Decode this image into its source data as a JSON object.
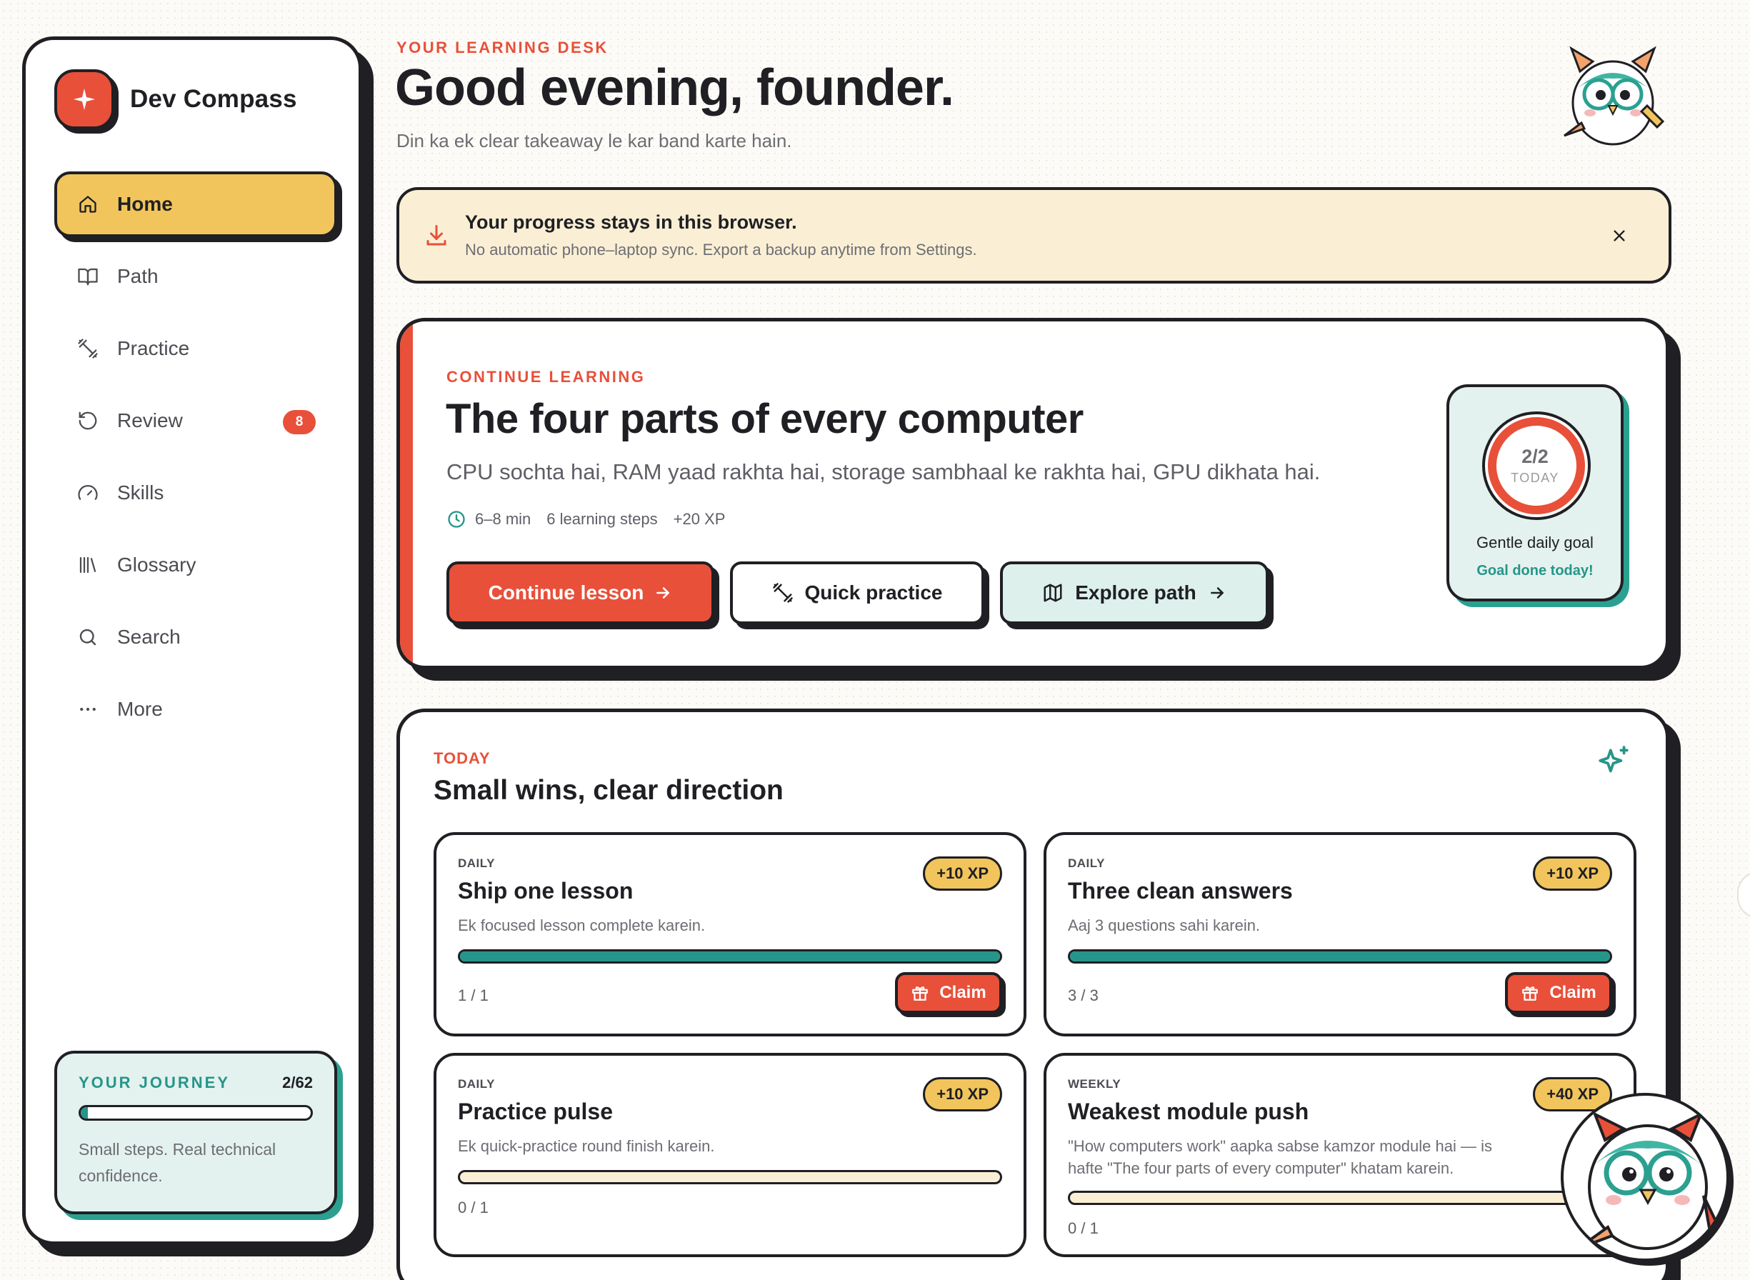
{
  "brand": {
    "name": "Dev Compass",
    "accent": "#e8503a"
  },
  "sidebar": {
    "items": [
      {
        "label": "Home",
        "icon": "home-icon",
        "active": true
      },
      {
        "label": "Path",
        "icon": "book-open-icon"
      },
      {
        "label": "Practice",
        "icon": "dumbbell-icon"
      },
      {
        "label": "Review",
        "icon": "rotate-ccw-icon",
        "badge": "8"
      },
      {
        "label": "Skills",
        "icon": "gauge-icon"
      },
      {
        "label": "Glossary",
        "icon": "library-icon"
      },
      {
        "label": "Search",
        "icon": "search-icon"
      },
      {
        "label": "More",
        "icon": "more-horizontal-icon"
      }
    ],
    "journey": {
      "title": "YOUR JOURNEY",
      "count": "2/62",
      "progress": 0.032,
      "text": "Small steps. Real technical confidence."
    }
  },
  "header": {
    "eyebrow": "YOUR LEARNING DESK",
    "title": "Good evening, founder.",
    "subtitle": "Din ka ek clear takeaway le kar band karte hain."
  },
  "notice": {
    "title": "Your progress stays in this browser.",
    "subtitle": "No automatic phone–laptop sync. Export a backup anytime from Settings."
  },
  "continue": {
    "eyebrow": "CONTINUE LEARNING",
    "title": "The four parts of every computer",
    "description": "CPU sochta hai, RAM yaad rakhta hai, storage sambhaal ke rakhta hai, GPU dikhata hai.",
    "meta": {
      "duration": "6–8 min",
      "steps": "6 learning steps",
      "xp": "+20 XP"
    },
    "buttons": {
      "primary": "Continue lesson",
      "practice": "Quick practice",
      "explore": "Explore path"
    },
    "goal": {
      "value": "2/2",
      "today": "TODAY",
      "progress": 1.0,
      "title": "Gentle daily goal",
      "status": "Goal done today!"
    }
  },
  "today": {
    "eyebrow": "TODAY",
    "title": "Small wins, clear direction",
    "quests": [
      {
        "kind": "DAILY",
        "title": "Ship one lesson",
        "desc": "Ek focused lesson complete karein.",
        "xp": "+10 XP",
        "progress": 1.0,
        "count": "1 / 1",
        "claim": "Claim"
      },
      {
        "kind": "DAILY",
        "title": "Three clean answers",
        "desc": "Aaj 3 questions sahi karein.",
        "xp": "+10 XP",
        "progress": 1.0,
        "count": "3 / 3",
        "claim": "Claim"
      },
      {
        "kind": "DAILY",
        "title": "Practice pulse",
        "desc": "Ek quick-practice round finish karein.",
        "xp": "+10 XP",
        "progress": 0.0,
        "count": "0 / 1"
      },
      {
        "kind": "WEEKLY",
        "title": "Weakest module push",
        "desc": "\"How computers work\" aapka sabse kamzor module hai — is hafte \"The four parts of every computer\" khatam karein.",
        "xp": "+40 XP",
        "progress": 0.0,
        "count": "0 / 1"
      }
    ]
  },
  "colors": {
    "ink": "#1f1f24",
    "coral": "#e8503a",
    "mustard": "#f2c55c",
    "teal": "#26958a",
    "cream": "#faefd4",
    "mint": "#e3f2ee"
  }
}
